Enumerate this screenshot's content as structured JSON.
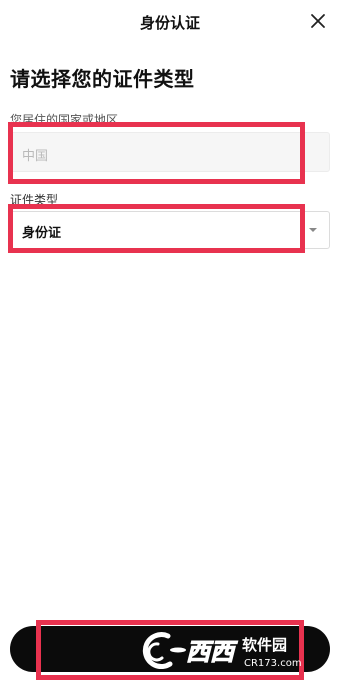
{
  "header": {
    "title": "身份认证",
    "close_icon": "close-icon"
  },
  "page": {
    "title": "请选择您的证件类型"
  },
  "country": {
    "label": "您居住的国家或地区",
    "value": "中国"
  },
  "id_type": {
    "label": "证件类型",
    "value": "身份证",
    "icon": "chevron-down-icon"
  },
  "submit": {
    "label": ""
  },
  "watermark": {
    "brand": "西西",
    "name": "软件园",
    "domain": "CR173.com"
  },
  "colors": {
    "highlight": "#e8324f",
    "button": "#0b0b0b",
    "input_disabled_bg": "#f6f6f6"
  }
}
